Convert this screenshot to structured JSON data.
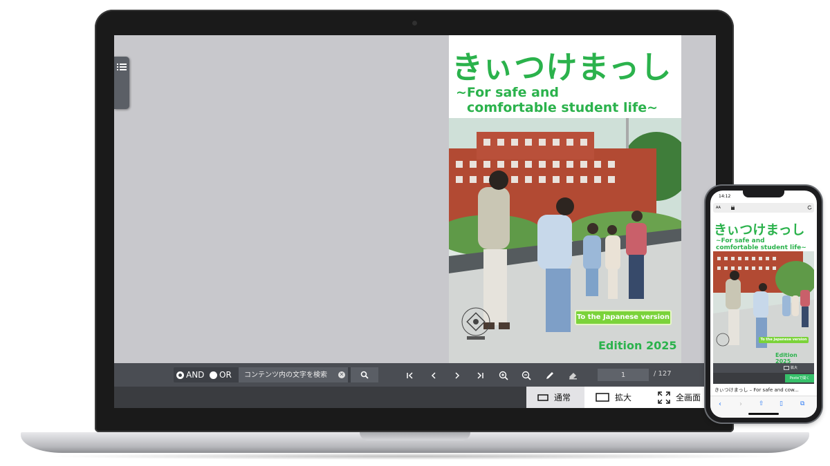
{
  "cover": {
    "title": "きぃつけまっし",
    "subtitle_line1": "~For safe and",
    "subtitle_line2": "comfortable student life~",
    "jp_version_button": "To the Japanese version",
    "edition": "Edition 2025"
  },
  "toolbar": {
    "and_label": "AND",
    "or_label": "OR",
    "search_placeholder": "コンテンツ内の文字を検索",
    "page_current": "1",
    "page_total": "/ 127"
  },
  "view_modes": {
    "normal": "通常",
    "zoom": "拡大",
    "fullscreen": "全画面"
  },
  "phone": {
    "time": "14:12",
    "url_aa": "AA",
    "title": "きぃつけまっし",
    "subtitle_line1": "~For safe and",
    "subtitle_line2": "comfortable student life~",
    "jp_version_button": "To the Japanese version",
    "edition": "Edition 2025",
    "zoom_label": "拡大",
    "poste_button": "Posteで開く",
    "footer_text": "きぃつけまっし – For safe and cow..."
  },
  "colors": {
    "accent_green": "#2bb24c",
    "button_green": "#7bd33a",
    "toolbar": "#4a4d53",
    "viewer_bg": "#c8c8cc"
  }
}
